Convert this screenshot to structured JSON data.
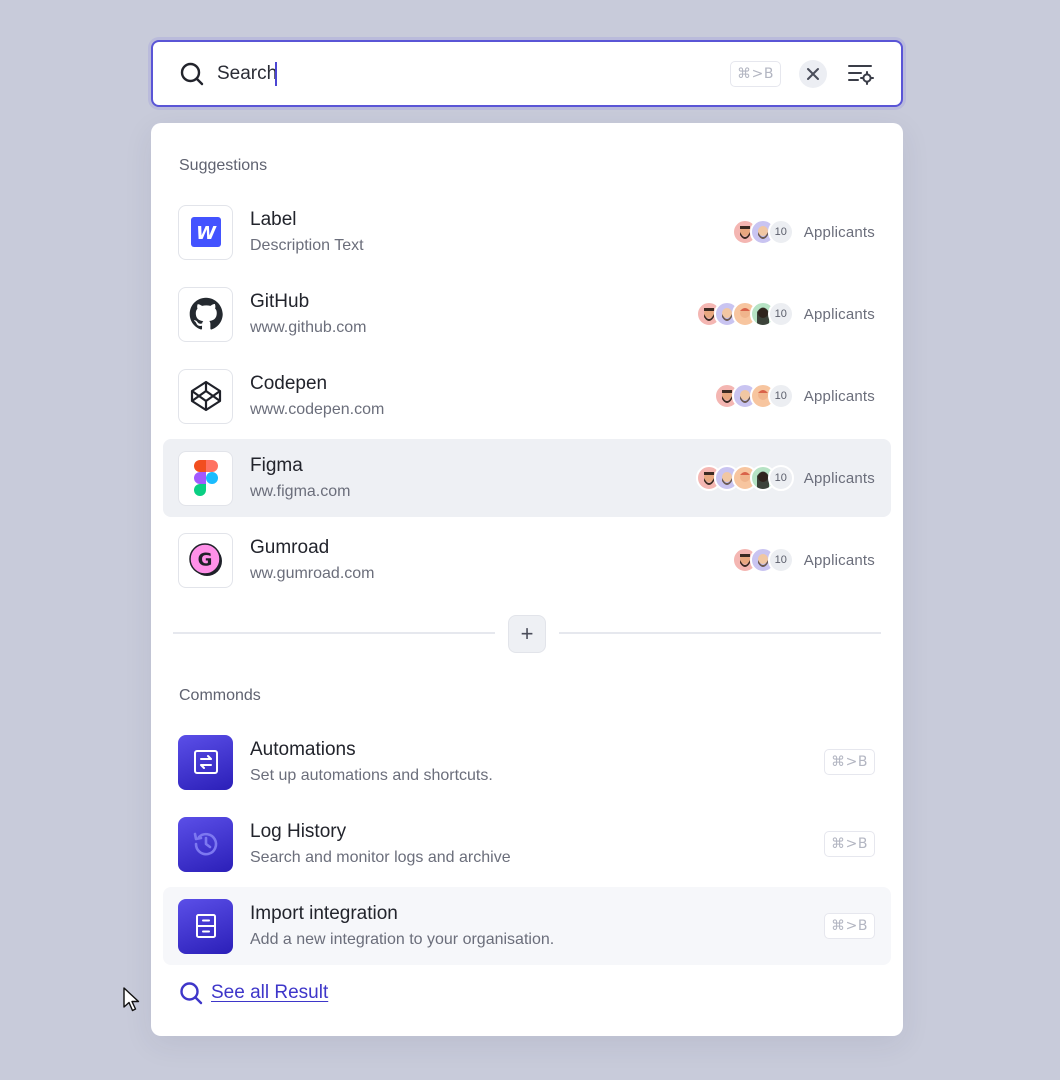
{
  "search": {
    "value": "Search",
    "shortcut": "⌘>B"
  },
  "suggestions": {
    "title": "Suggestions",
    "items": [
      {
        "icon": "webflow-icon",
        "title": "Label",
        "subtitle": "Description Text",
        "count": "10",
        "count_label": "Applicants",
        "avatars": 2
      },
      {
        "icon": "github-icon",
        "title": "GitHub",
        "subtitle": "www.github.com",
        "count": "10",
        "count_label": "Applicants",
        "avatars": 4
      },
      {
        "icon": "codepen-icon",
        "title": "Codepen",
        "subtitle": "www.codepen.com",
        "count": "10",
        "count_label": "Applicants",
        "avatars": 3
      },
      {
        "icon": "figma-icon",
        "title": "Figma",
        "subtitle": "ww.figma.com",
        "count": "10",
        "count_label": "Applicants",
        "avatars": 4
      },
      {
        "icon": "gumroad-icon",
        "title": "Gumroad",
        "subtitle": "ww.gumroad.com",
        "count": "10",
        "count_label": "Applicants",
        "avatars": 2
      }
    ],
    "add_label": "+"
  },
  "commands": {
    "title": "Commonds",
    "items": [
      {
        "icon": "automation-icon",
        "title": "Automations",
        "subtitle": "Set up automations and shortcuts.",
        "shortcut": "⌘>B"
      },
      {
        "icon": "history-icon",
        "title": "Log History",
        "subtitle": "Search and monitor logs and archive",
        "shortcut": "⌘>B"
      },
      {
        "icon": "archive-icon",
        "title": "Import integration",
        "subtitle": "Add a new integration to your organisation.",
        "shortcut": "⌘>B"
      }
    ]
  },
  "see_all": "See all Result",
  "colors": {
    "accent": "#4b46d3",
    "background": "#c8cbda",
    "highlight_row": "#eef0f4"
  }
}
